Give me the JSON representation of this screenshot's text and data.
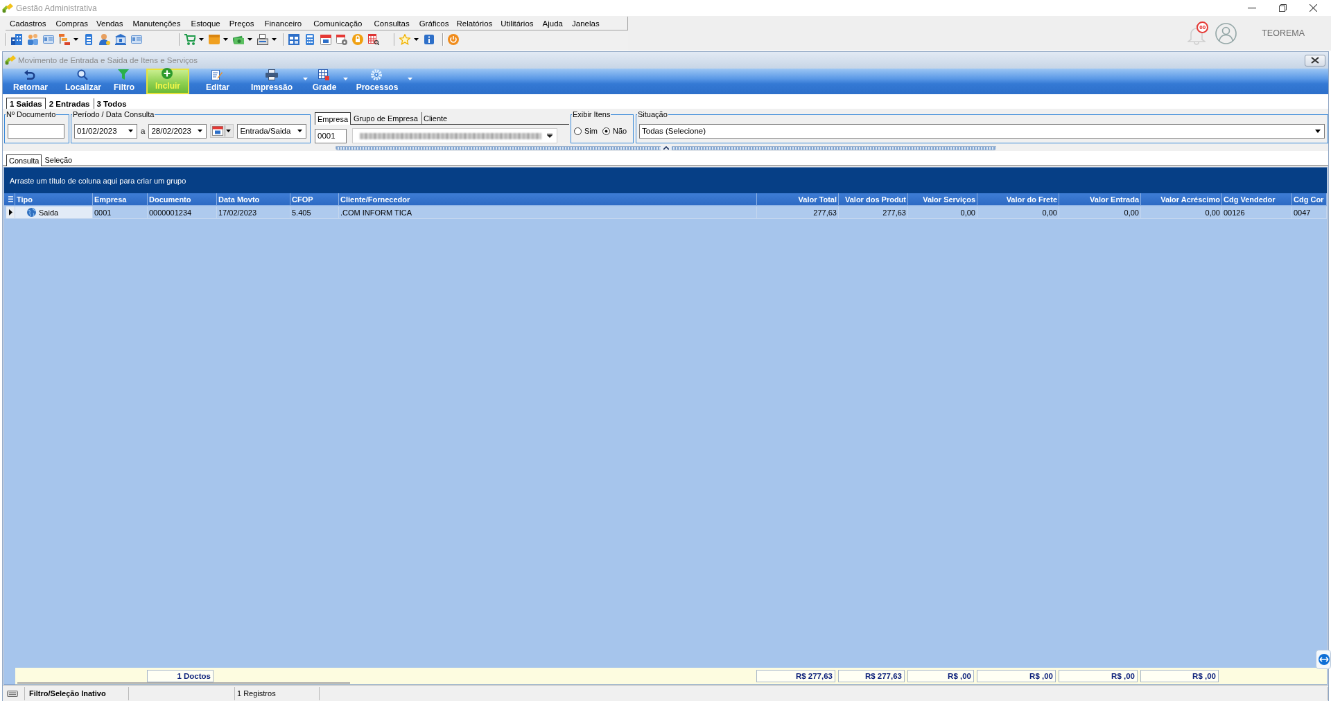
{
  "window": {
    "title": "Gestão Administrativa"
  },
  "menu": [
    {
      "label": "Cadastros"
    },
    {
      "label": "Compras"
    },
    {
      "label": "Vendas"
    },
    {
      "label": "Manutenções"
    },
    {
      "label": "Estoque"
    },
    {
      "label": "Preços"
    },
    {
      "label": "Financeiro"
    },
    {
      "label": "Comunicação"
    },
    {
      "label": "Consultas"
    },
    {
      "label": "Gráficos"
    },
    {
      "label": "Relatórios"
    },
    {
      "label": "Utilitários"
    },
    {
      "label": "Ajuda"
    },
    {
      "label": "Janelas"
    }
  ],
  "account": {
    "notifications": "00",
    "user": "TEOREMA"
  },
  "form": {
    "title": "Movimento de Entrada e Saida de Itens e Serviços"
  },
  "actions": [
    {
      "label": "Retornar",
      "dropdown": false,
      "highlighted": false
    },
    {
      "label": "Localizar",
      "dropdown": false,
      "highlighted": false
    },
    {
      "label": "Filtro",
      "dropdown": false,
      "highlighted": false
    },
    {
      "label": "Incluir",
      "dropdown": false,
      "highlighted": true
    },
    {
      "label": "Editar",
      "dropdown": false,
      "highlighted": false
    },
    {
      "label": "Impressão",
      "dropdown": true,
      "highlighted": false
    },
    {
      "label": "Grade",
      "dropdown": true,
      "highlighted": false
    },
    {
      "label": "Processos",
      "dropdown": true,
      "highlighted": false
    }
  ],
  "mode_tabs": [
    {
      "label": "1 Saidas",
      "selected": true
    },
    {
      "label": "2 Entradas",
      "selected": false
    },
    {
      "label": "3 Todos",
      "selected": false
    }
  ],
  "filters": {
    "document": {
      "legend": "Nº Documento"
    },
    "period": {
      "legend": "Período / Data Consulta",
      "from": "01/02/2023",
      "separator": "a",
      "to": "28/02/2023",
      "direction": "Entrada/Saida"
    },
    "company": {
      "tabs": [
        {
          "label": "Empresa",
          "selected": true
        },
        {
          "label": "Grupo de Empresa",
          "selected": false
        },
        {
          "label": "Cliente",
          "selected": false
        }
      ],
      "code": "0001"
    },
    "show_items": {
      "legend": "Exibir Itens",
      "options": [
        {
          "label": "Sim",
          "selected": false
        },
        {
          "label": "Não",
          "selected": true
        }
      ]
    },
    "status": {
      "legend": "Situação",
      "value": "Todas (Selecione)"
    }
  },
  "view_tabs": [
    {
      "label": "Consulta",
      "selected": true
    },
    {
      "label": "Seleção",
      "selected": false
    }
  ],
  "grid": {
    "group_hint": "Arraste um título de coluna aqui para criar um grupo",
    "columns": [
      {
        "title": "Tipo",
        "kind": "text"
      },
      {
        "title": "Empresa",
        "kind": "text"
      },
      {
        "title": "Documento",
        "kind": "document"
      },
      {
        "title": "Data Movto",
        "kind": "text"
      },
      {
        "title": "CFOP",
        "kind": "text"
      },
      {
        "title": "Cliente/Fornecedor",
        "kind": "text"
      },
      {
        "title": "Valor Total",
        "kind": "amount"
      },
      {
        "title": "Valor dos Produt",
        "kind": "amount"
      },
      {
        "title": "Valor Serviços",
        "kind": "amount"
      },
      {
        "title": "Valor do Frete",
        "kind": "amount"
      },
      {
        "title": "Valor Entrada",
        "kind": "amount"
      },
      {
        "title": "Valor Acréscimo",
        "kind": "amount"
      },
      {
        "title": "Cdg Vendedor",
        "kind": "text"
      },
      {
        "title": "Cdg Cor",
        "kind": "text"
      }
    ],
    "rows": [
      {
        "selected": true,
        "cells": [
          "Saida",
          "0001",
          "0000001234",
          "17/02/2023",
          "5.405",
          ".COM INFORM TICA",
          "277,63",
          "277,63",
          "0,00",
          "0,00",
          "0,00",
          "0,00",
          "00126",
          "0047"
        ]
      }
    ],
    "footer": {
      "count": "1 Doctos",
      "totals": [
        "R$ 277,63",
        "R$ 277,63",
        "R$ ,00",
        "R$ ,00",
        "R$ ,00",
        "R$ ,00"
      ]
    }
  },
  "status_bar": {
    "filter": "Filtro/Seleção Inativo",
    "records": "1 Registros"
  }
}
